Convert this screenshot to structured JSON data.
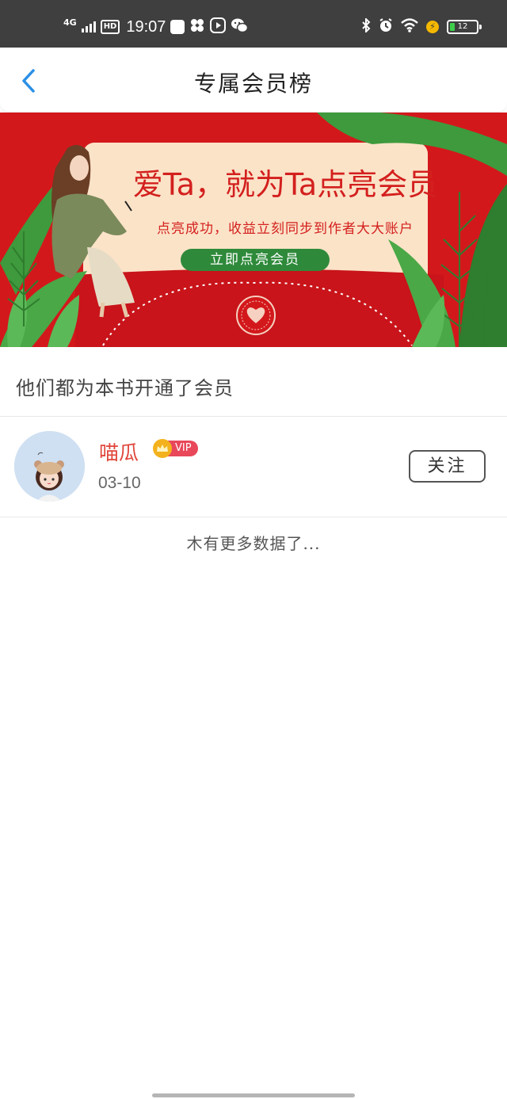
{
  "status_bar": {
    "network": "4G",
    "hd": "HD",
    "time": "19:07",
    "battery_level": "12",
    "icons": [
      "pinwheel-app-icon",
      "video-app-icon",
      "wechat-icon",
      "bluetooth-icon",
      "alarm-icon",
      "wifi-icon",
      "charging-icon",
      "battery-icon"
    ]
  },
  "header": {
    "title": "专属会员榜"
  },
  "banner": {
    "headline": "爱Ta，就为Ta点亮会员",
    "subtitle": "点亮成功，收益立刻同步到作者大大账户",
    "button_label": "立即点亮会员",
    "colors": {
      "background": "#d3181c",
      "card": "#fbe3c8",
      "button": "#2e8a3a",
      "leaf": "#3e9a3c"
    }
  },
  "section": {
    "title": "他们都为本书开通了会员"
  },
  "members": [
    {
      "name": "喵瓜",
      "vip_label": "VIP",
      "date": "03-10",
      "follow_label": "关注"
    }
  ],
  "footer": {
    "no_more_text": "木有更多数据了..."
  },
  "colors": {
    "accent_blue": "#2b8fe6",
    "name_red": "#e0463a",
    "vip_pink": "#e8485a",
    "crown_gold": "#f3b21d"
  }
}
